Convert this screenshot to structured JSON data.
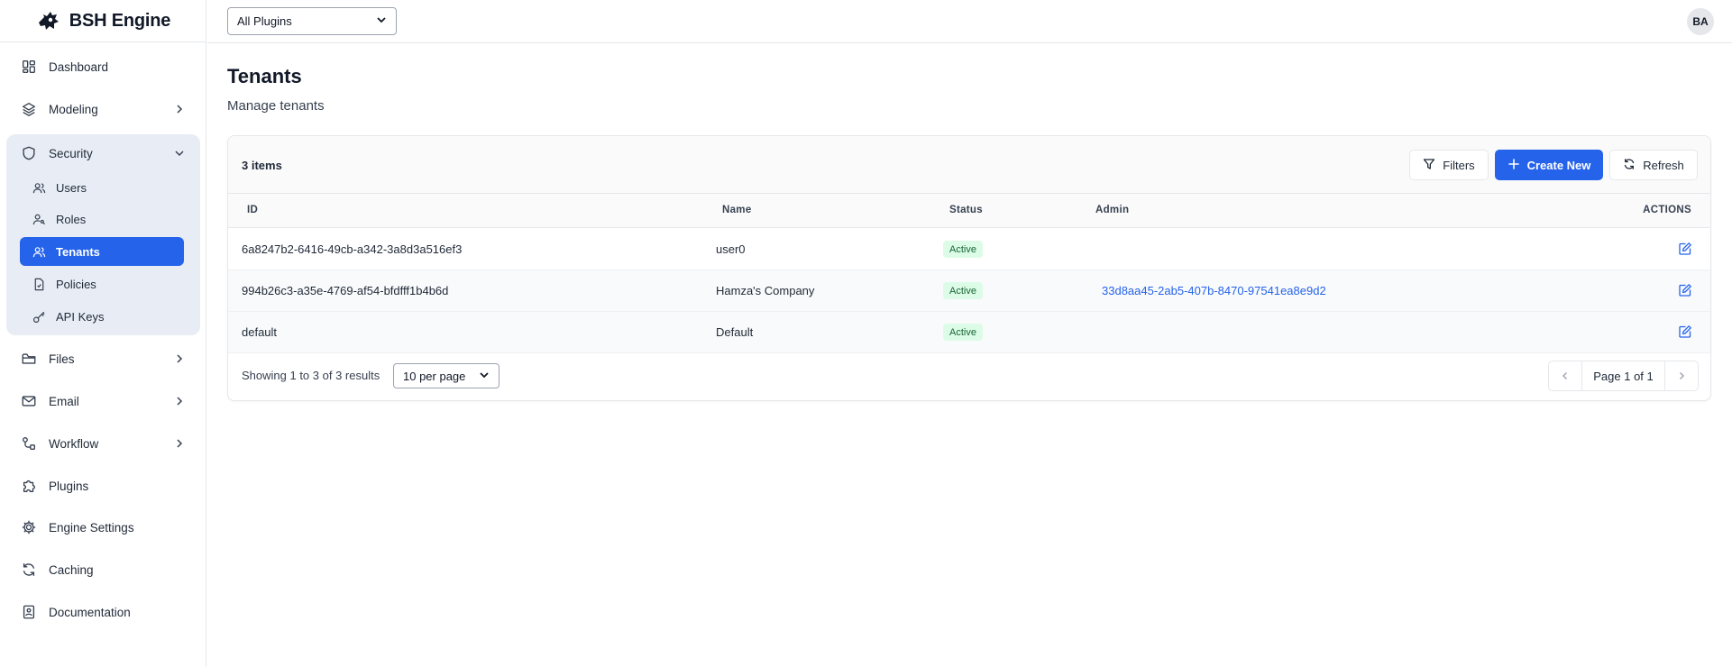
{
  "brand": {
    "name": "BSH Engine"
  },
  "topbar": {
    "plugin_filter": "All Plugins",
    "avatar_initials": "BA"
  },
  "sidebar": {
    "items": [
      {
        "label": "Dashboard",
        "icon": "dashboard-icon"
      },
      {
        "label": "Modeling",
        "icon": "layers-icon",
        "expandable": true
      },
      {
        "label": "Security",
        "icon": "shield-icon",
        "expanded": true
      },
      {
        "label": "Files",
        "icon": "folder-icon",
        "expandable": true
      },
      {
        "label": "Email",
        "icon": "mail-icon",
        "expandable": true
      },
      {
        "label": "Workflow",
        "icon": "workflow-icon",
        "expandable": true
      },
      {
        "label": "Plugins",
        "icon": "puzzle-icon"
      },
      {
        "label": "Engine Settings",
        "icon": "gear-icon"
      },
      {
        "label": "Caching",
        "icon": "refresh-icon"
      },
      {
        "label": "Documentation",
        "icon": "book-icon"
      }
    ],
    "security_sub": [
      {
        "label": "Users",
        "icon": "users-icon"
      },
      {
        "label": "Roles",
        "icon": "user-key-icon"
      },
      {
        "label": "Tenants",
        "icon": "users-icon",
        "active": true
      },
      {
        "label": "Policies",
        "icon": "file-check-icon"
      },
      {
        "label": "API Keys",
        "icon": "key-icon"
      }
    ]
  },
  "page": {
    "title": "Tenants",
    "subtitle": "Manage tenants"
  },
  "toolbar": {
    "items_count": "3 items",
    "filters_label": "Filters",
    "create_label": "Create New",
    "refresh_label": "Refresh"
  },
  "table": {
    "headers": {
      "id": "ID",
      "name": "Name",
      "status": "Status",
      "admin": "Admin",
      "actions": "ACTIONS"
    },
    "rows": [
      {
        "id": "6a8247b2-6416-49cb-a342-3a8d3a516ef3",
        "name": "user0",
        "status": "Active",
        "admin": ""
      },
      {
        "id": "994b26c3-a35e-4769-af54-bfdfff1b4b6d",
        "name": "Hamza's Company",
        "status": "Active",
        "admin": "33d8aa45-2ab5-407b-8470-97541ea8e9d2"
      },
      {
        "id": "default",
        "name": "Default",
        "status": "Active",
        "admin": ""
      }
    ]
  },
  "footer": {
    "showing": "Showing 1 to 3 of 3 results",
    "per_page": "10 per page",
    "page_label": "Page 1 of 1"
  },
  "colors": {
    "accent": "#2563eb",
    "active_badge_bg": "#dcfce7",
    "active_badge_text": "#166534",
    "security_group_bg": "#e8edf5"
  }
}
